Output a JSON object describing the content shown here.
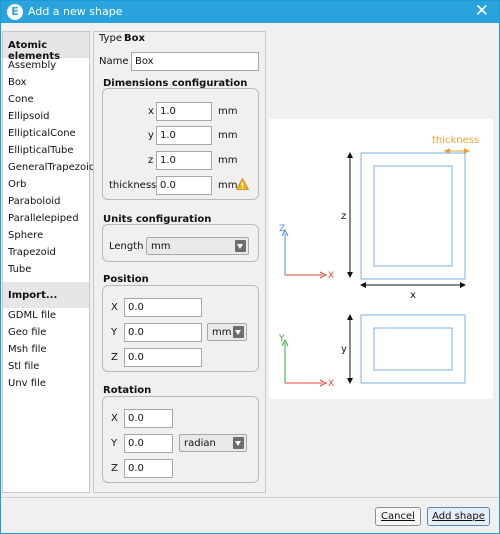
{
  "window": {
    "title": "Add a new shape",
    "icon_letter": "E",
    "close_glyph": "✕"
  },
  "sidebar": {
    "atomic_header": "Atomic elements",
    "shapes": [
      "Assembly",
      "Box",
      "Cone",
      "Ellipsoid",
      "EllipticalCone",
      "EllipticalTube",
      "GeneralTrapezoid",
      "Orb",
      "Paraboloid",
      "Parallelepiped",
      "Sphere",
      "Trapezoid",
      "Tube"
    ],
    "import_header": "Import...",
    "import_items": [
      "GDML file",
      "Geo file",
      "Msh file",
      "Stl file",
      "Unv file"
    ]
  },
  "form": {
    "type_label": "Type",
    "type_value": "Box",
    "name_label": "Name",
    "name_value": "Box",
    "dimensions": {
      "title": "Dimensions configuration",
      "x": {
        "label": "x",
        "value": "1.0",
        "unit": "mm"
      },
      "y": {
        "label": "y",
        "value": "1.0",
        "unit": "mm"
      },
      "z": {
        "label": "z",
        "value": "1.0",
        "unit": "mm"
      },
      "thickness": {
        "label": "thickness",
        "value": "0.0",
        "unit": "mm",
        "warning_glyph": "!"
      }
    },
    "units": {
      "title": "Units configuration",
      "length_label": "Length",
      "length_value": "mm"
    },
    "position": {
      "title": "Position",
      "x": {
        "label": "X",
        "value": "0.0"
      },
      "y": {
        "label": "Y",
        "value": "0.0"
      },
      "z": {
        "label": "Z",
        "value": "0.0"
      },
      "unit": "mm"
    },
    "rotation": {
      "title": "Rotation",
      "x": {
        "label": "X",
        "value": "0.0"
      },
      "y": {
        "label": "Y",
        "value": "0.0"
      },
      "z": {
        "label": "Z",
        "value": "0.0"
      },
      "unit": "radian"
    }
  },
  "preview": {
    "thickness_label": "thickness",
    "dim_z": "z",
    "dim_x": "x",
    "dim_y": "y",
    "axis_labels": {
      "z": "Z",
      "y": "Y",
      "x1": "X",
      "x2": "X"
    },
    "colors": {
      "accent_orange": "#f0a030",
      "box_blue": "#7fb2e5",
      "axis_blue": "#4a8fd8",
      "axis_red": "#e04a3a",
      "axis_green": "#3aa63a"
    }
  },
  "buttons": {
    "cancel": "Cancel",
    "add": "Add shape"
  }
}
